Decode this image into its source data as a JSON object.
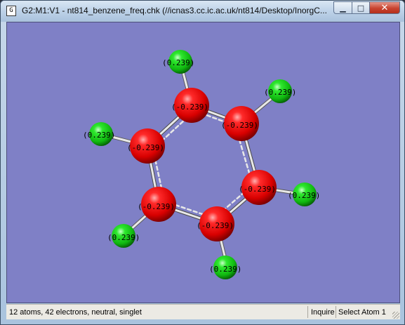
{
  "window": {
    "icon_glyph": "G",
    "title": "G2:M1:V1 - nt814_benzene_freq.chk (//icnas3.cc.ic.ac.uk/nt814/Desktop/InorgC..."
  },
  "caption_buttons": {
    "minimize_glyph": "▁",
    "maximize_glyph": "□",
    "close_glyph": "✕"
  },
  "molecule": {
    "carbon_color": "#e00000",
    "hydrogen_color": "#10d010",
    "bond_color": "#e8e8e8",
    "carbon_charge_label": "(-0.239)",
    "hydrogen_charge_label": "(0.239)",
    "atoms": [
      {
        "element": "C",
        "label": "(-0.239)"
      },
      {
        "element": "C",
        "label": "(-0.239)"
      },
      {
        "element": "C",
        "label": "(-0.239)"
      },
      {
        "element": "C",
        "label": "(-0.239)"
      },
      {
        "element": "C",
        "label": "(-0.239)"
      },
      {
        "element": "C",
        "label": "(-0.239)"
      },
      {
        "element": "H",
        "label": "(0.239)"
      },
      {
        "element": "H",
        "label": "(0.239)"
      },
      {
        "element": "H",
        "label": "(0.239)"
      },
      {
        "element": "H",
        "label": "(0.239)"
      },
      {
        "element": "H",
        "label": "(0.239)"
      },
      {
        "element": "H",
        "label": "(0.239)"
      }
    ]
  },
  "statusbar": {
    "info": "12 atoms, 42 electrons, neutral, singlet",
    "mode": "Inquire",
    "action": "Select Atom 1"
  }
}
